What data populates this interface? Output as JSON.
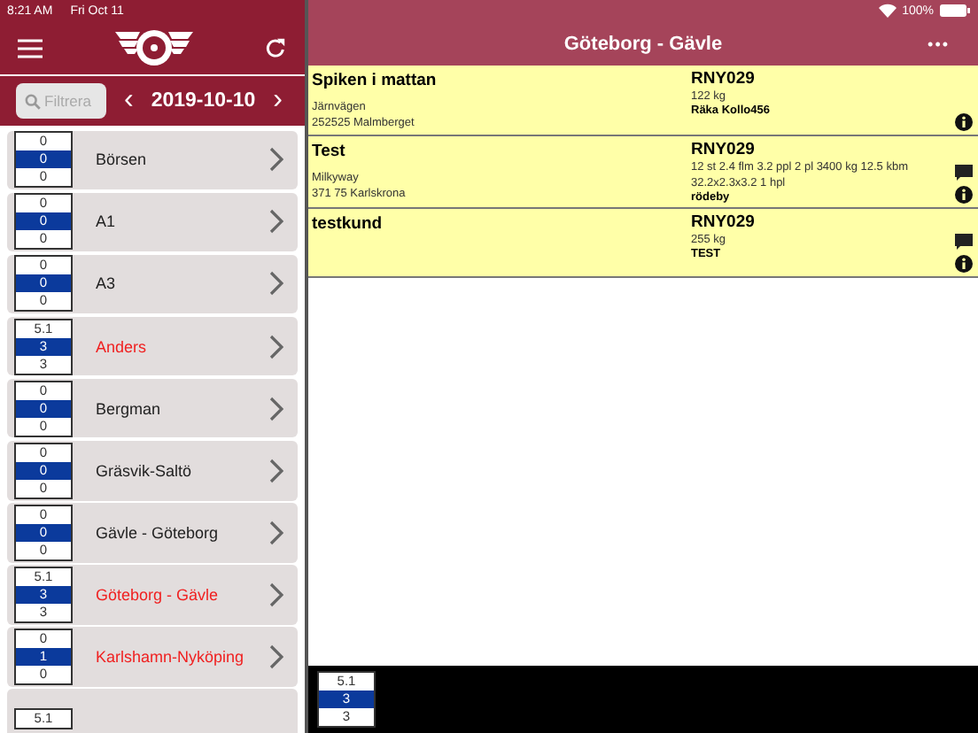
{
  "status_bar": {
    "time": "8:21 AM",
    "date": "Fri Oct 11",
    "battery": "100%"
  },
  "sidebar": {
    "search": {
      "placeholder": "Filtrera"
    },
    "date": "2019-10-10",
    "prev": "‹",
    "next": "›",
    "items": [
      {
        "name": "Börsen",
        "counts": [
          "0",
          "0",
          "0"
        ],
        "highlighted": false
      },
      {
        "name": "A1",
        "counts": [
          "0",
          "0",
          "0"
        ],
        "highlighted": false
      },
      {
        "name": "A3",
        "counts": [
          "0",
          "0",
          "0"
        ],
        "highlighted": false
      },
      {
        "name": "Anders",
        "counts": [
          "5.1",
          "3",
          "3"
        ],
        "highlighted": true
      },
      {
        "name": "Bergman",
        "counts": [
          "0",
          "0",
          "0"
        ],
        "highlighted": false
      },
      {
        "name": "Gräsvik-Saltö",
        "counts": [
          "0",
          "0",
          "0"
        ],
        "highlighted": false
      },
      {
        "name": "Gävle - Göteborg",
        "counts": [
          "0",
          "0",
          "0"
        ],
        "highlighted": false
      },
      {
        "name": "Göteborg - Gävle",
        "counts": [
          "5.1",
          "3",
          "3"
        ],
        "highlighted": true
      },
      {
        "name": "Karlshamn-Nyköping",
        "counts": [
          "0",
          "1",
          "0"
        ],
        "highlighted": true
      },
      {
        "counts": [
          "5.1"
        ]
      }
    ]
  },
  "detail": {
    "title": "Göteborg - Gävle",
    "more": "•••",
    "orders": [
      {
        "customer": "Spiken i mattan",
        "address": [
          "Järnvägen",
          "252525 Malmberget"
        ],
        "ref": "RNY029",
        "details": [
          "122 kg"
        ],
        "note": "Räka Kollo456",
        "comment": false,
        "info": true
      },
      {
        "customer": "Test",
        "address": [
          "Milkyway",
          "371 75 Karlskrona"
        ],
        "ref": "RNY029",
        "details": [
          "12 st 2.4 flm 3.2 ppl 2 pl 3400 kg 12.5 kbm",
          "32.2x2.3x3.2 1 hpl"
        ],
        "note": "rödeby",
        "comment": true,
        "info": true
      },
      {
        "customer": "testkund",
        "ref": "RNY029",
        "details": [
          "255 kg"
        ],
        "note": "TEST",
        "comment": true,
        "info": true
      }
    ],
    "totals": [
      "5.1",
      "3",
      "3"
    ]
  }
}
